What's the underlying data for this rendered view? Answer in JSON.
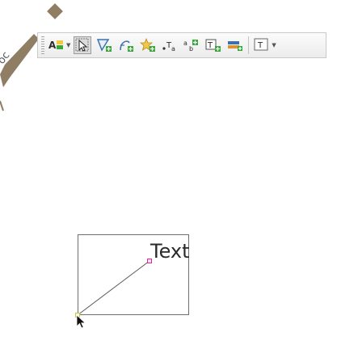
{
  "canvas": {
    "text_item_label": "Text"
  },
  "toolbar": {
    "items": [
      {
        "name": "label-tools-menu",
        "icon": "label-style-icon",
        "has_dropdown": true
      },
      {
        "name": "select-tool",
        "icon": "pointer-select-icon",
        "active": true
      },
      {
        "name": "add-polygon-tool",
        "icon": "polygon-add-icon"
      },
      {
        "name": "add-curve-tool",
        "icon": "curve-add-icon"
      },
      {
        "name": "add-point-tool",
        "icon": "star-point-icon"
      },
      {
        "name": "label-tool",
        "icon": "label-text-icon"
      },
      {
        "name": "pin-labels-tool",
        "icon": "pin-labels-icon"
      },
      {
        "name": "add-text-box-tool",
        "icon": "text-box-add-icon"
      },
      {
        "name": "add-layer-tool",
        "icon": "layer-color-icon"
      },
      {
        "name": "text-annotation-tool",
        "icon": "text-annotation-icon",
        "has_dropdown": true
      }
    ]
  },
  "colors": {
    "handle": "#d1309b",
    "icon_green": "#3aa83a",
    "icon_blue": "#3a6fb0",
    "star_yellow": "#f2c84b"
  }
}
